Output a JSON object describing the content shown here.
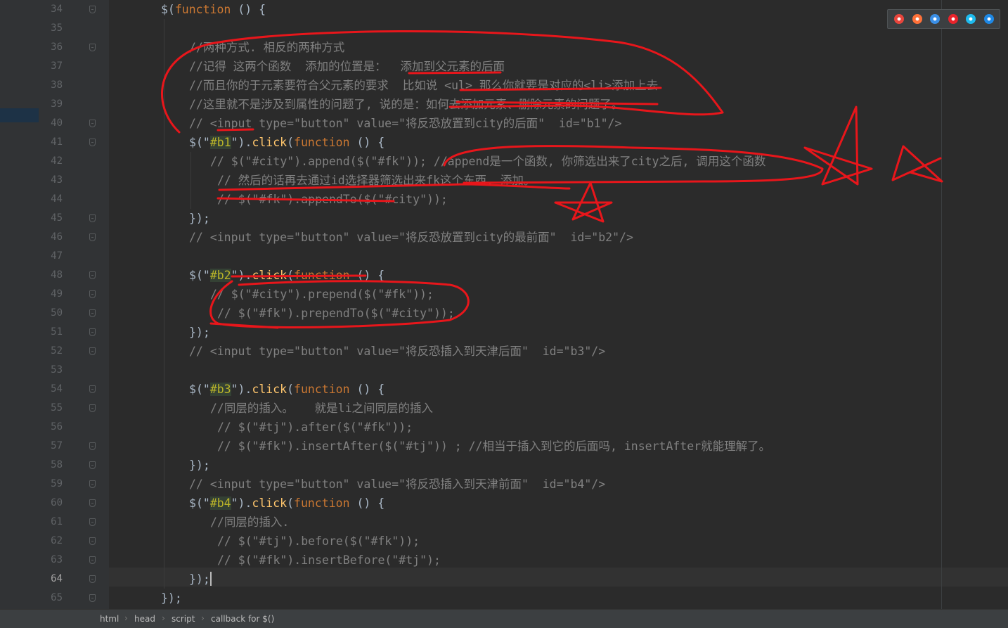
{
  "editor": {
    "current_line": "64",
    "line_numbers": [
      "34",
      "35",
      "36",
      "37",
      "38",
      "39",
      "40",
      "41",
      "42",
      "43",
      "44",
      "45",
      "46",
      "47",
      "48",
      "49",
      "50",
      "51",
      "52",
      "53",
      "54",
      "55",
      "56",
      "57",
      "58",
      "59",
      "60",
      "61",
      "62",
      "63",
      "64",
      "65"
    ],
    "lines": {
      "l34": {
        "pre": "$(",
        "kw": "function",
        "post": " () {"
      },
      "l36": "//两种方式. 相反的两种方式",
      "l37": "//记得 这两个函数  添加的位置是：  添加到父元素的后面",
      "l38": "//而且你的于元素要符合父元素的要求  比如说 <ul> 那么你就要是对应的<li>添加上去",
      "l39": "//这里就不是涉及到属性的问题了, 说的是：如何去添加元素、删除元素的问题了。",
      "l40": "// <input type=\"button\" value=\"将反恐放置到city的后面\"  id=\"b1\"/>",
      "l41": {
        "pre": "$(\"",
        "sel": "#b1",
        "mid": "\").",
        "fn": "click",
        "open": "(",
        "kw": "function",
        "post": " () {"
      },
      "l42": {
        "code": "// $(\"#city\").append($(\"#fk\")); //append是一个函数, 你筛选出来了city之后, 调用这个函数"
      },
      "l43": "// 然后的话再去通过id选择器筛选出来fk这个东西, 添加。",
      "l44": "// $(\"#fk\").appendTo($(\"#city\"));",
      "l45": "});",
      "l46": "// <input type=\"button\" value=\"将反恐放置到city的最前面\"  id=\"b2\"/>",
      "l48": {
        "pre": "$(\"",
        "sel": "#b2",
        "mid": "\").",
        "fn": "click",
        "open": "(",
        "kw": "function",
        "post": " () {"
      },
      "l49": "// $(\"#city\").prepend($(\"#fk\"));",
      "l50": "// $(\"#fk\").prependTo($(\"#city\"));",
      "l51": "});",
      "l52": "// <input type=\"button\" value=\"将反恐插入到天津后面\"  id=\"b3\"/>",
      "l54": {
        "pre": "$(\"",
        "sel": "#b3",
        "mid": "\").",
        "fn": "click",
        "open": "(",
        "kw": "function",
        "post": " () {"
      },
      "l55": "//同层的插入。   就是li之间同层的插入",
      "l56": "// $(\"#tj\").after($(\"#fk\"));",
      "l57": "// $(\"#fk\").insertAfter($(\"#tj\")) ; //相当于插入到它的后面吗, insertAfter就能理解了。",
      "l58": "});",
      "l59": "// <input type=\"button\" value=\"将反恐插入到天津前面\"  id=\"b4\"/>",
      "l60": {
        "pre": "$(\"",
        "sel": "#b4",
        "mid": "\").",
        "fn": "click",
        "open": "(",
        "kw": "function",
        "post": " () {"
      },
      "l61": "//同层的插入.",
      "l62": "// $(\"#tj\").before($(\"#fk\"));",
      "l63": "// $(\"#fk\").insertBefore(\"#tj\");",
      "l64": "});",
      "l65": "});"
    }
  },
  "browsers": [
    {
      "name": "chrome-icon",
      "color": "#e8453c"
    },
    {
      "name": "firefox-icon",
      "color": "#ff7139"
    },
    {
      "name": "safari-icon",
      "color": "#3b8fe6"
    },
    {
      "name": "opera-icon",
      "color": "#e8232b"
    },
    {
      "name": "ie-icon",
      "color": "#1ebbee"
    },
    {
      "name": "edge-icon",
      "color": "#1e88e5"
    }
  ],
  "breadcrumb": [
    "html",
    "head",
    "script",
    "callback for $()"
  ],
  "annotation_color": "#e8161b"
}
